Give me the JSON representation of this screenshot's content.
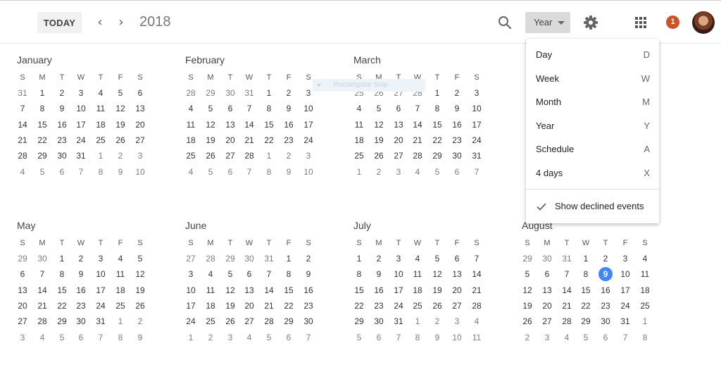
{
  "header": {
    "today_label": "TODAY",
    "prev_icon": "chevron-left-icon",
    "next_icon": "chevron-right-icon",
    "year": "2018",
    "search_icon": "search-icon",
    "view_selected": "Year",
    "settings_icon": "gear-icon",
    "apps_icon": "apps-grid-icon",
    "notification_count": "1",
    "colors": {
      "badge": "#c5552b",
      "today_highlight": "#4285f4"
    }
  },
  "weekdays": [
    "S",
    "M",
    "T",
    "W",
    "T",
    "F",
    "S"
  ],
  "months": [
    {
      "name": "January",
      "weeks": [
        [
          "31",
          "1",
          "2",
          "3",
          "4",
          "5",
          "6"
        ],
        [
          "7",
          "8",
          "9",
          "10",
          "11",
          "12",
          "13"
        ],
        [
          "14",
          "15",
          "16",
          "17",
          "18",
          "19",
          "20"
        ],
        [
          "21",
          "22",
          "23",
          "24",
          "25",
          "26",
          "27"
        ],
        [
          "28",
          "29",
          "30",
          "31",
          "1",
          "2",
          "3"
        ],
        [
          "4",
          "5",
          "6",
          "7",
          "8",
          "9",
          "10"
        ]
      ],
      "lead": 1,
      "trail": 10
    },
    {
      "name": "February",
      "weeks": [
        [
          "28",
          "29",
          "30",
          "31",
          "1",
          "2",
          "3"
        ],
        [
          "4",
          "5",
          "6",
          "7",
          "8",
          "9",
          "10"
        ],
        [
          "11",
          "12",
          "13",
          "14",
          "15",
          "16",
          "17"
        ],
        [
          "18",
          "19",
          "20",
          "21",
          "22",
          "23",
          "24"
        ],
        [
          "25",
          "26",
          "27",
          "28",
          "1",
          "2",
          "3"
        ],
        [
          "4",
          "5",
          "6",
          "7",
          "8",
          "9",
          "10"
        ]
      ],
      "lead": 4,
      "trail": 10
    },
    {
      "name": "March",
      "weeks": [
        [
          "25",
          "26",
          "27",
          "28",
          "1",
          "2",
          "3"
        ],
        [
          "4",
          "5",
          "6",
          "7",
          "8",
          "9",
          "10"
        ],
        [
          "11",
          "12",
          "13",
          "14",
          "15",
          "16",
          "17"
        ],
        [
          "18",
          "19",
          "20",
          "21",
          "22",
          "23",
          "24"
        ],
        [
          "25",
          "26",
          "27",
          "28",
          "29",
          "30",
          "31"
        ],
        [
          "1",
          "2",
          "3",
          "4",
          "5",
          "6",
          "7"
        ]
      ],
      "lead": 4,
      "trail": 7
    },
    {
      "name": "May",
      "weeks": [
        [
          "29",
          "30",
          "1",
          "2",
          "3",
          "4",
          "5"
        ],
        [
          "6",
          "7",
          "8",
          "9",
          "10",
          "11",
          "12"
        ],
        [
          "13",
          "14",
          "15",
          "16",
          "17",
          "18",
          "19"
        ],
        [
          "20",
          "21",
          "22",
          "23",
          "24",
          "25",
          "26"
        ],
        [
          "27",
          "28",
          "29",
          "30",
          "31",
          "1",
          "2"
        ],
        [
          "3",
          "4",
          "5",
          "6",
          "7",
          "8",
          "9"
        ]
      ],
      "lead": 2,
      "trail": 9
    },
    {
      "name": "June",
      "weeks": [
        [
          "27",
          "28",
          "29",
          "30",
          "31",
          "1",
          "2"
        ],
        [
          "3",
          "4",
          "5",
          "6",
          "7",
          "8",
          "9"
        ],
        [
          "10",
          "11",
          "12",
          "13",
          "14",
          "15",
          "16"
        ],
        [
          "17",
          "18",
          "19",
          "20",
          "21",
          "22",
          "23"
        ],
        [
          "24",
          "25",
          "26",
          "27",
          "28",
          "29",
          "30"
        ],
        [
          "1",
          "2",
          "3",
          "4",
          "5",
          "6",
          "7"
        ]
      ],
      "lead": 5,
      "trail": 7
    },
    {
      "name": "July",
      "weeks": [
        [
          "1",
          "2",
          "3",
          "4",
          "5",
          "6",
          "7"
        ],
        [
          "8",
          "9",
          "10",
          "11",
          "12",
          "13",
          "14"
        ],
        [
          "15",
          "16",
          "17",
          "18",
          "19",
          "20",
          "21"
        ],
        [
          "22",
          "23",
          "24",
          "25",
          "26",
          "27",
          "28"
        ],
        [
          "29",
          "30",
          "31",
          "1",
          "2",
          "3",
          "4"
        ],
        [
          "5",
          "6",
          "7",
          "8",
          "9",
          "10",
          "11"
        ]
      ],
      "lead": 0,
      "trail": 11
    },
    {
      "name": "August",
      "weeks": [
        [
          "29",
          "30",
          "31",
          "1",
          "2",
          "3",
          "4"
        ],
        [
          "5",
          "6",
          "7",
          "8",
          "9",
          "10",
          "11"
        ],
        [
          "12",
          "13",
          "14",
          "15",
          "16",
          "17",
          "18"
        ],
        [
          "19",
          "20",
          "21",
          "22",
          "23",
          "24",
          "25"
        ],
        [
          "26",
          "27",
          "28",
          "29",
          "30",
          "31",
          "1"
        ],
        [
          "2",
          "3",
          "4",
          "5",
          "6",
          "7",
          "8"
        ]
      ],
      "lead": 3,
      "trail": 8,
      "today": "9"
    }
  ],
  "ghost_chip_label": "Rectangular Snip",
  "view_menu": {
    "items": [
      {
        "label": "Day",
        "shortcut": "D"
      },
      {
        "label": "Week",
        "shortcut": "W"
      },
      {
        "label": "Month",
        "shortcut": "M"
      },
      {
        "label": "Year",
        "shortcut": "Y"
      },
      {
        "label": "Schedule",
        "shortcut": "A"
      },
      {
        "label": "4 days",
        "shortcut": "X"
      }
    ],
    "declined_label": "Show declined events",
    "declined_checked": true,
    "check_icon": "check-icon"
  }
}
